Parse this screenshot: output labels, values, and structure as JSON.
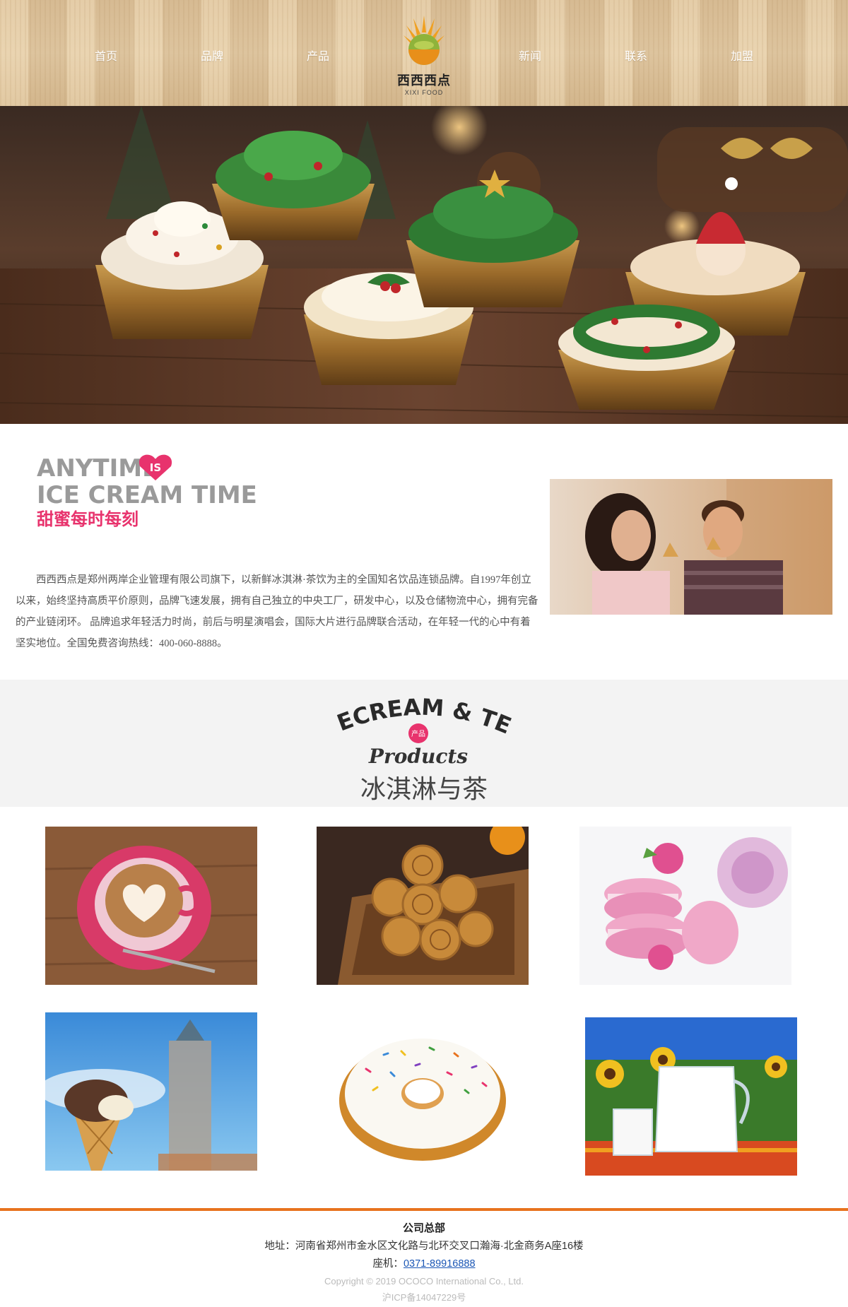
{
  "nav": {
    "items": [
      {
        "label": "首页"
      },
      {
        "label": "品牌"
      },
      {
        "label": "产品"
      },
      {
        "label": "新闻"
      },
      {
        "label": "联系"
      },
      {
        "label": "加盟"
      }
    ]
  },
  "logo": {
    "name": "西西西点",
    "sub": "XIXI FOOD"
  },
  "about": {
    "headline_1": "ANYTIME",
    "headline_badge": "IS",
    "headline_2": "ICE CREAM TIME",
    "headline_cn": "甜蜜每时每刻",
    "text": "西西西点是郑州两岸企业管理有限公司旗下，以新鲜冰淇淋·茶饮为主的全国知名饮品连锁品牌。自1997年创立以来，始终坚持高质平价原则，品牌飞速发展，拥有自己独立的中央工厂，研发中心，以及仓储物流中心，拥有完备的产业链闭环。 品牌追求年轻活力时尚，前后与明星演唱会，国际大片进行品牌联合活动，在年轻一代的心中有着坚实地位。全国免费咨询热线：400-060-8888。"
  },
  "products": {
    "script_title": "ICECREAM & TEA",
    "badge": "产品",
    "script_sub": "Products",
    "title": "冰淇淋与茶"
  },
  "footer": {
    "title": "公司总部",
    "address": "地址：河南省郑州市金水区文化路与北环交叉口瀚海·北金商务A座16楼",
    "phone_label": "座机：",
    "phone": "0371-89916888",
    "copyright": "Copyright © 2019 OCOCO International Co., Ltd.",
    "icp": "沪ICP备14047229号"
  },
  "colors": {
    "accent": "#e8731e",
    "brand_pink": "#e8336d",
    "link": "#1a56b5"
  }
}
